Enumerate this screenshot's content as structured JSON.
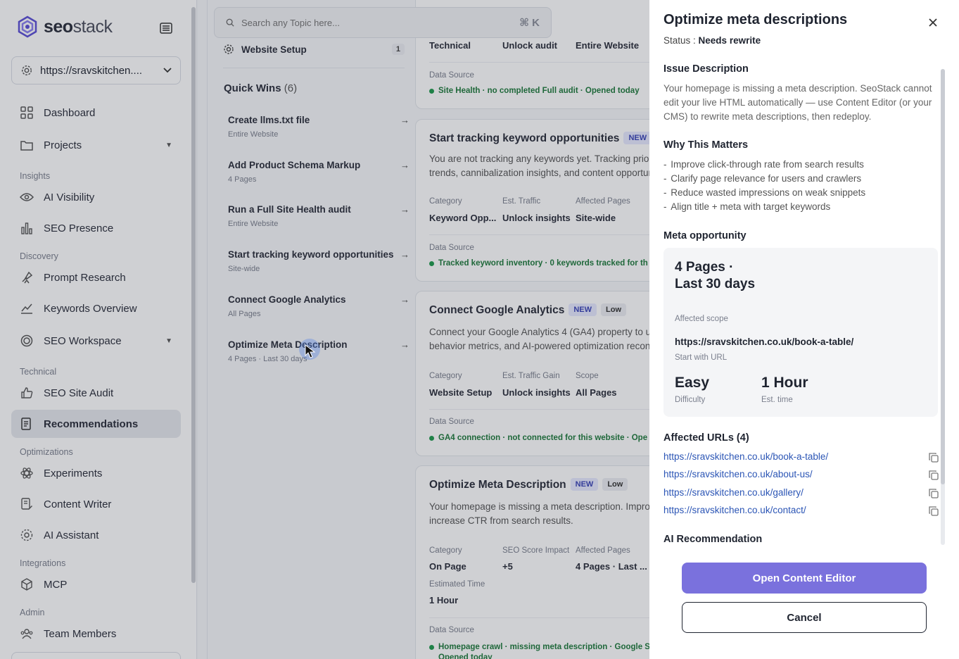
{
  "brand": {
    "name_part1": "seo",
    "name_part2": "stack"
  },
  "site_selector": {
    "value": "https://sravskitchen...."
  },
  "sidebar": {
    "items": [
      {
        "label": "Dashboard",
        "icon": "grid-icon"
      },
      {
        "label": "Projects",
        "icon": "folder-icon"
      },
      {
        "label": "AI Visibility",
        "icon": "eye-icon"
      },
      {
        "label": "SEO Presence",
        "icon": "bar-chart-icon"
      },
      {
        "label": "Prompt Research",
        "icon": "telescope-icon"
      },
      {
        "label": "Keywords Overview",
        "icon": "trend-icon"
      },
      {
        "label": "SEO Workspace",
        "icon": "target-icon"
      },
      {
        "label": "SEO Site Audit",
        "icon": "thumbs-up-icon"
      },
      {
        "label": "Recommendations",
        "icon": "document-icon"
      },
      {
        "label": "Experiments",
        "icon": "atom-icon"
      },
      {
        "label": "Content Writer",
        "icon": "pen-doc-icon"
      },
      {
        "label": "AI Assistant",
        "icon": "sparkle-icon"
      },
      {
        "label": "MCP",
        "icon": "cube-icon"
      },
      {
        "label": "Team Members",
        "icon": "team-icon"
      }
    ],
    "sections": [
      "Insights",
      "Discovery",
      "Technical",
      "Optimizations",
      "Integrations",
      "Admin"
    ]
  },
  "search": {
    "placeholder": "Search any Topic here...",
    "shortcut": "⌘ K"
  },
  "workspace_row": {
    "label": "Website Setup",
    "count": "1"
  },
  "quick_wins": {
    "heading": "Quick Wins",
    "count": "(6)",
    "items": [
      {
        "title": "Create llms.txt file",
        "sub": "Entire Website"
      },
      {
        "title": "Add Product Schema Markup",
        "sub": "4 Pages"
      },
      {
        "title": "Run a Full Site Health audit",
        "sub": "Entire Website"
      },
      {
        "title": "Start tracking keyword opportunities",
        "sub": "Site-wide"
      },
      {
        "title": "Connect Google Analytics",
        "sub": "All Pages"
      },
      {
        "title": "Optimize Meta Description",
        "sub": "4 Pages · Last 30 days"
      }
    ]
  },
  "cards": {
    "top": {
      "meta": [
        "Technical",
        "Unlock audit",
        "Entire Website"
      ],
      "ds_label": "Data Source",
      "ds": "Site Health · no completed Full audit · Opened today"
    },
    "keyword": {
      "title": "Start tracking keyword opportunities",
      "badge_new": "NEW",
      "desc1": "You are not tracking any keywords yet. Tracking prior",
      "desc2": "trends, cannibalization insights, and content opportur",
      "labels": [
        "Category",
        "Est. Traffic",
        "Affected Pages"
      ],
      "values": [
        "Keyword Opp...",
        "Unlock insights",
        "Site-wide"
      ],
      "ds_label": "Data Source",
      "ds": "Tracked keyword inventory · 0 keywords tracked for th"
    },
    "ga": {
      "title": "Connect Google Analytics",
      "badge_new": "NEW",
      "badge_low": "Low",
      "desc1": "Connect your Google Analytics 4 (GA4) property to u",
      "desc2": "behavior metrics, and AI-powered optimization recon",
      "labels": [
        "Category",
        "Est. Traffic Gain",
        "Scope"
      ],
      "values": [
        "Website Setup",
        "Unlock insights",
        "All Pages"
      ],
      "ds_label": "Data Source",
      "ds": "GA4 connection · not connected for this website · Ope"
    },
    "meta": {
      "title": "Optimize Meta Description",
      "badge_new": "NEW",
      "badge_low": "Low",
      "desc1": "Your homepage is missing a meta description. Improv",
      "desc2": "increase CTR from search results.",
      "labels": [
        "Category",
        "SEO Score Impact",
        "Affected Pages"
      ],
      "values": [
        "On Page",
        "+5",
        "4 Pages · Last ..."
      ],
      "time_label": "Estimated Time",
      "time_value": "1 Hour",
      "ds_label": "Data Source",
      "ds": "Homepage crawl · missing meta description · Google S",
      "ds2": "Opened today"
    }
  },
  "drawer": {
    "title": "Optimize meta descriptions",
    "status_label": "Status :",
    "status_value": "Needs rewrite",
    "issue_heading": "Issue Description",
    "issue_text": "Your homepage is missing a meta description. SeoStack cannot edit your live HTML automatically — use Content Editor (or your CMS) to rewrite meta descriptions, then redeploy.",
    "why_heading": "Why This Matters",
    "why_items": [
      "Improve click-through rate from search results",
      "Clarify page relevance for users and crawlers",
      "Reduce wasted impressions on weak snippets",
      "Align title + meta with target keywords"
    ],
    "opp_heading": "Meta opportunity",
    "opp_scope": "4 Pages · Last 30 days",
    "opp_scope_label": "Affected scope",
    "opp_url": "https://sravskitchen.co.uk/book-a-table/",
    "opp_url_label": "Start with URL",
    "opp_difficulty": "Easy",
    "opp_difficulty_label": "Difficulty",
    "opp_time": "1 Hour",
    "opp_time_label": "Est. time",
    "urls_heading": "Affected URLs (4)",
    "urls": [
      "https://sravskitchen.co.uk/book-a-table/",
      "https://sravskitchen.co.uk/about-us/",
      "https://sravskitchen.co.uk/gallery/",
      "https://sravskitchen.co.uk/contact/"
    ],
    "ai_heading": "AI Recommendation",
    "primary_button": "Open Content Editor",
    "secondary_button": "Cancel"
  },
  "colors": {
    "accent": "#7a71dd",
    "link": "#2b55b5",
    "success": "#1e7a3c"
  }
}
